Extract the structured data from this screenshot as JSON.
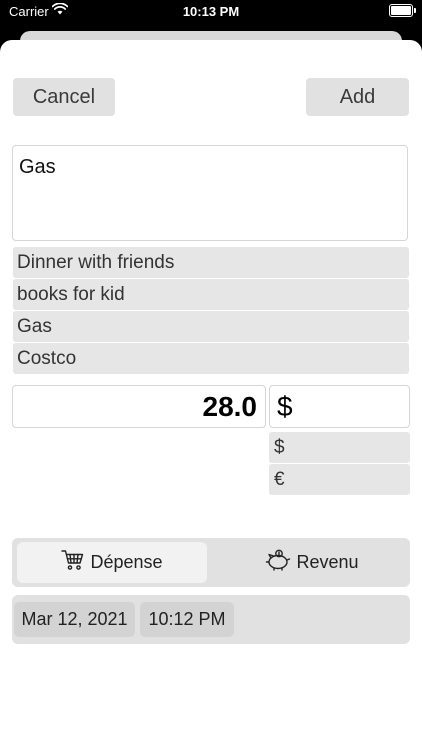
{
  "status_bar": {
    "carrier": "Carrier",
    "time": "10:13 PM"
  },
  "header": {
    "cancel_label": "Cancel",
    "add_label": "Add"
  },
  "name_input": {
    "value": "Gas"
  },
  "suggestions": [
    "Dinner with friends",
    "books for kid",
    "Gas",
    "Costco"
  ],
  "amount": {
    "value": "28.0"
  },
  "currency": {
    "selected": "$",
    "options": [
      "$",
      "€"
    ]
  },
  "type_segment": {
    "options": [
      {
        "label": "Dépense",
        "icon": "cart-icon",
        "selected": true
      },
      {
        "label": "Revenu",
        "icon": "piggy-bank-icon",
        "selected": false
      }
    ]
  },
  "date_time": {
    "date": "Mar 12, 2021",
    "time": "10:12 PM"
  }
}
